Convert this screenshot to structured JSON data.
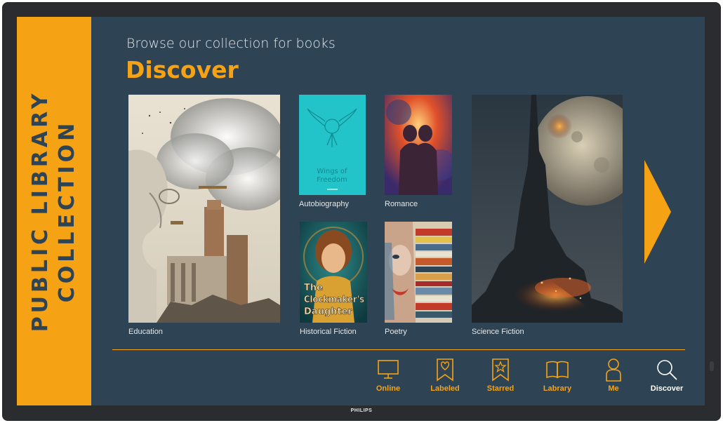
{
  "device": {
    "brand": "PHILIPS"
  },
  "sidebar": {
    "line1": "PUBLIC LIBRARY",
    "line2": "COLLECTION"
  },
  "header": {
    "subtitle": "Browse our collection for books",
    "title": "Discover"
  },
  "books": {
    "education": {
      "label": "Education"
    },
    "autobiography": {
      "label": "Autobiography",
      "cover_title_1": "Wings of",
      "cover_title_2": "Freedom"
    },
    "romance": {
      "label": "Romance"
    },
    "historical": {
      "label": "Historical Fiction",
      "cover_title_1": "The",
      "cover_title_2": "Clockmaker's",
      "cover_title_3": "Daughter"
    },
    "poetry": {
      "label": "Poetry"
    },
    "scifi": {
      "label": "Science Fiction"
    }
  },
  "nav": {
    "online": {
      "label": "Online",
      "icon": "monitor-icon"
    },
    "labeled": {
      "label": "Labeled",
      "icon": "bookmark-heart-icon"
    },
    "starred": {
      "label": "Starred",
      "icon": "bookmark-star-icon"
    },
    "library": {
      "label": "Labrary",
      "icon": "open-book-icon"
    },
    "me": {
      "label": "Me",
      "icon": "person-icon"
    },
    "discover": {
      "label": "Discover",
      "icon": "search-icon"
    }
  },
  "colors": {
    "accent": "#f5a315",
    "background": "#2e4455",
    "bezel": "#2a2c2f",
    "active_nav": "#ffffff"
  }
}
